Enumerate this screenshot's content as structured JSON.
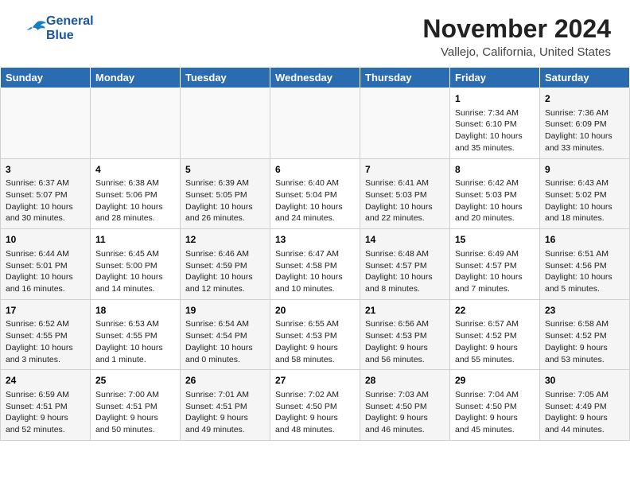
{
  "header": {
    "title": "November 2024",
    "subtitle": "Vallejo, California, United States",
    "logo_text_general": "General",
    "logo_text_blue": "Blue"
  },
  "calendar": {
    "days_of_week": [
      "Sunday",
      "Monday",
      "Tuesday",
      "Wednesday",
      "Thursday",
      "Friday",
      "Saturday"
    ],
    "weeks": [
      [
        {
          "day": "",
          "info": "",
          "empty": true
        },
        {
          "day": "",
          "info": "",
          "empty": true
        },
        {
          "day": "",
          "info": "",
          "empty": true
        },
        {
          "day": "",
          "info": "",
          "empty": true
        },
        {
          "day": "",
          "info": "",
          "empty": true
        },
        {
          "day": "1",
          "info": "Sunrise: 7:34 AM\nSunset: 6:10 PM\nDaylight: 10 hours\nand 35 minutes."
        },
        {
          "day": "2",
          "info": "Sunrise: 7:36 AM\nSunset: 6:09 PM\nDaylight: 10 hours\nand 33 minutes."
        }
      ],
      [
        {
          "day": "3",
          "info": "Sunrise: 6:37 AM\nSunset: 5:07 PM\nDaylight: 10 hours\nand 30 minutes."
        },
        {
          "day": "4",
          "info": "Sunrise: 6:38 AM\nSunset: 5:06 PM\nDaylight: 10 hours\nand 28 minutes."
        },
        {
          "day": "5",
          "info": "Sunrise: 6:39 AM\nSunset: 5:05 PM\nDaylight: 10 hours\nand 26 minutes."
        },
        {
          "day": "6",
          "info": "Sunrise: 6:40 AM\nSunset: 5:04 PM\nDaylight: 10 hours\nand 24 minutes."
        },
        {
          "day": "7",
          "info": "Sunrise: 6:41 AM\nSunset: 5:03 PM\nDaylight: 10 hours\nand 22 minutes."
        },
        {
          "day": "8",
          "info": "Sunrise: 6:42 AM\nSunset: 5:03 PM\nDaylight: 10 hours\nand 20 minutes."
        },
        {
          "day": "9",
          "info": "Sunrise: 6:43 AM\nSunset: 5:02 PM\nDaylight: 10 hours\nand 18 minutes."
        }
      ],
      [
        {
          "day": "10",
          "info": "Sunrise: 6:44 AM\nSunset: 5:01 PM\nDaylight: 10 hours\nand 16 minutes."
        },
        {
          "day": "11",
          "info": "Sunrise: 6:45 AM\nSunset: 5:00 PM\nDaylight: 10 hours\nand 14 minutes."
        },
        {
          "day": "12",
          "info": "Sunrise: 6:46 AM\nSunset: 4:59 PM\nDaylight: 10 hours\nand 12 minutes."
        },
        {
          "day": "13",
          "info": "Sunrise: 6:47 AM\nSunset: 4:58 PM\nDaylight: 10 hours\nand 10 minutes."
        },
        {
          "day": "14",
          "info": "Sunrise: 6:48 AM\nSunset: 4:57 PM\nDaylight: 10 hours\nand 8 minutes."
        },
        {
          "day": "15",
          "info": "Sunrise: 6:49 AM\nSunset: 4:57 PM\nDaylight: 10 hours\nand 7 minutes."
        },
        {
          "day": "16",
          "info": "Sunrise: 6:51 AM\nSunset: 4:56 PM\nDaylight: 10 hours\nand 5 minutes."
        }
      ],
      [
        {
          "day": "17",
          "info": "Sunrise: 6:52 AM\nSunset: 4:55 PM\nDaylight: 10 hours\nand 3 minutes."
        },
        {
          "day": "18",
          "info": "Sunrise: 6:53 AM\nSunset: 4:55 PM\nDaylight: 10 hours\nand 1 minute."
        },
        {
          "day": "19",
          "info": "Sunrise: 6:54 AM\nSunset: 4:54 PM\nDaylight: 10 hours\nand 0 minutes."
        },
        {
          "day": "20",
          "info": "Sunrise: 6:55 AM\nSunset: 4:53 PM\nDaylight: 9 hours\nand 58 minutes."
        },
        {
          "day": "21",
          "info": "Sunrise: 6:56 AM\nSunset: 4:53 PM\nDaylight: 9 hours\nand 56 minutes."
        },
        {
          "day": "22",
          "info": "Sunrise: 6:57 AM\nSunset: 4:52 PM\nDaylight: 9 hours\nand 55 minutes."
        },
        {
          "day": "23",
          "info": "Sunrise: 6:58 AM\nSunset: 4:52 PM\nDaylight: 9 hours\nand 53 minutes."
        }
      ],
      [
        {
          "day": "24",
          "info": "Sunrise: 6:59 AM\nSunset: 4:51 PM\nDaylight: 9 hours\nand 52 minutes."
        },
        {
          "day": "25",
          "info": "Sunrise: 7:00 AM\nSunset: 4:51 PM\nDaylight: 9 hours\nand 50 minutes."
        },
        {
          "day": "26",
          "info": "Sunrise: 7:01 AM\nSunset: 4:51 PM\nDaylight: 9 hours\nand 49 minutes."
        },
        {
          "day": "27",
          "info": "Sunrise: 7:02 AM\nSunset: 4:50 PM\nDaylight: 9 hours\nand 48 minutes."
        },
        {
          "day": "28",
          "info": "Sunrise: 7:03 AM\nSunset: 4:50 PM\nDaylight: 9 hours\nand 46 minutes."
        },
        {
          "day": "29",
          "info": "Sunrise: 7:04 AM\nSunset: 4:50 PM\nDaylight: 9 hours\nand 45 minutes."
        },
        {
          "day": "30",
          "info": "Sunrise: 7:05 AM\nSunset: 4:49 PM\nDaylight: 9 hours\nand 44 minutes."
        }
      ]
    ]
  }
}
